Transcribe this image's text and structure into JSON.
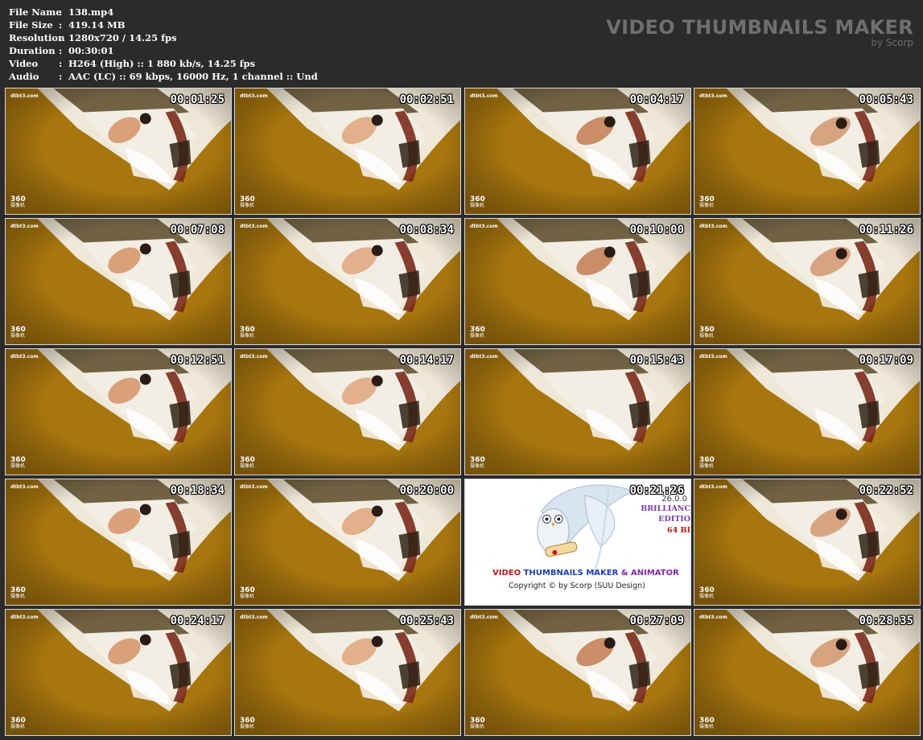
{
  "meta": [
    {
      "key": "File Name",
      "value": "138.mp4"
    },
    {
      "key": "File Size",
      "value": "419.14 MB"
    },
    {
      "key": "Resolution",
      "value": "1280x720 / 14.25 fps"
    },
    {
      "key": "Duration",
      "value": "00:30:01"
    },
    {
      "key": "Video",
      "value": "H264 (High) :: 1 880 kb/s, 14.25 fps"
    },
    {
      "key": "Audio",
      "value": "AAC (LC) :: 69 kbps, 16000 Hz, 1 channel :: Und"
    }
  ],
  "meta_sep": ":",
  "brand": {
    "title": "VIDEO THUMBNAILS MAKER",
    "subtitle": "by Scorp"
  },
  "watermark": {
    "site": "dtbt3.com",
    "logo": "360",
    "logo_sub": "摄像机"
  },
  "thumbnails": [
    {
      "time": "00:01:25"
    },
    {
      "time": "00:02:51"
    },
    {
      "time": "00:04:17"
    },
    {
      "time": "00:05:43"
    },
    {
      "time": "00:07:08"
    },
    {
      "time": "00:08:34"
    },
    {
      "time": "00:10:00"
    },
    {
      "time": "00:11:26"
    },
    {
      "time": "00:12:51"
    },
    {
      "time": "00:14:17"
    },
    {
      "time": "00:15:43"
    },
    {
      "time": "00:17:09"
    },
    {
      "time": "00:18:34"
    },
    {
      "time": "00:20:00"
    },
    {
      "time": "00:21:26"
    },
    {
      "time": "00:22:52"
    },
    {
      "time": "00:24:17"
    },
    {
      "time": "00:25:43"
    },
    {
      "time": "00:27:09"
    },
    {
      "time": "00:28:35"
    }
  ],
  "promo": {
    "line1_a": "VIDEO ",
    "line1_b": "THUMBNAILS MAKER ",
    "line1_c": "& ANIMATOR",
    "line2": "Copyright © by Scorp (SUU Design)",
    "version": "26.0.0",
    "edition1": "BRILLIANC",
    "edition2": "EDITIO",
    "edition3": "64 BI"
  },
  "colors": {
    "background": "#2b2b2b",
    "wall": "#a8760e",
    "bed_sheet": "#f2eee4",
    "headboard": "#5a4a2a",
    "brand_text": "#6f6f6f"
  }
}
